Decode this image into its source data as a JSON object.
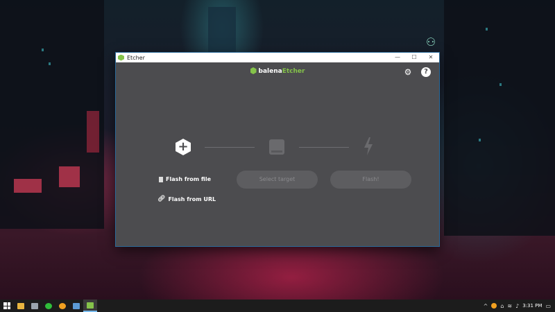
{
  "window": {
    "title": "Etcher",
    "controls": {
      "minimize": "—",
      "maximize": "☐",
      "close": "✕"
    }
  },
  "brand": {
    "part1": "balena",
    "part2": "Etcher"
  },
  "icons": {
    "settings": "⚙",
    "help": "?",
    "plus": "+"
  },
  "steps": {
    "flash_from_file": "Flash from file",
    "flash_from_url": "Flash from URL",
    "select_target": "Select target",
    "flash": "Flash!"
  },
  "taskbar": {
    "time": "3:31 PM",
    "apps": [
      "start",
      "file-explorer",
      "devices",
      "messaging",
      "browser",
      "files",
      "etcher"
    ]
  },
  "colors": {
    "accent": "#85c34a",
    "window_bg": "#4c4c4f",
    "pill_bg": "#5d5d60",
    "pill_text": "#8a8a8d"
  }
}
